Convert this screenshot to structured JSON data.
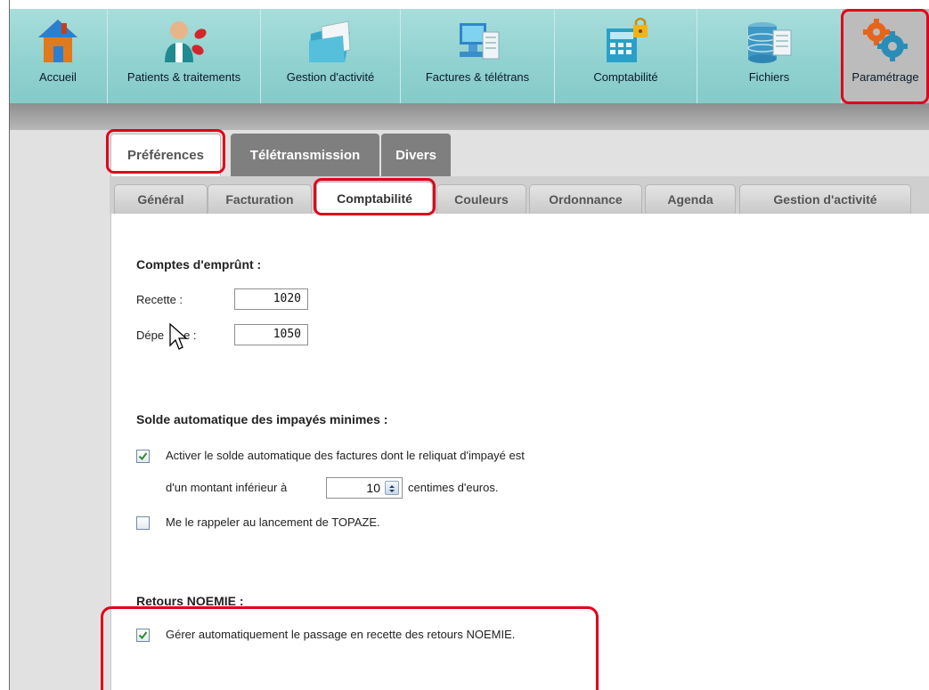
{
  "toolbar": {
    "items": [
      {
        "label": "Accueil",
        "icon": "home-icon"
      },
      {
        "label": "Patients & traitements",
        "icon": "patients-icon"
      },
      {
        "label": "Gestion d'activité",
        "icon": "folder-icon"
      },
      {
        "label": "Factures & télétrans",
        "icon": "computer-icon"
      },
      {
        "label": "Comptabilité",
        "icon": "calculator-lock-icon"
      },
      {
        "label": "Fichiers",
        "icon": "database-icon"
      },
      {
        "label": "Paramétrage",
        "icon": "gears-icon",
        "active": true
      }
    ]
  },
  "tabs_main": [
    "Préférences",
    "Télétransmission",
    "Divers"
  ],
  "tabs_sub": [
    "Général",
    "Facturation",
    "Comptabilité",
    "Couleurs",
    "Ordonnance",
    "Agenda",
    "Gestion d'activité"
  ],
  "accounts": {
    "title": "Comptes d'emprûnt :",
    "recette_label": "Recette :",
    "recette_value": "1020",
    "depense_label_start": "Dépe",
    "depense_label_end": "e :",
    "depense_value": "1050"
  },
  "solde": {
    "title": "Solde automatique des impayés minimes :",
    "enable_label_1": "Activer le solde automatique des factures dont le reliquat d'impayé est",
    "enable_label_2": "d'un montant inférieur à",
    "amount": "10",
    "unit": "centimes d'euros.",
    "enable_checked": true,
    "reminder_label": "Me le rappeler au lancement de TOPAZE.",
    "reminder_checked": false
  },
  "noemie": {
    "title": "Retours NOEMIE :",
    "label": "Gérer automatiquement le passage en recette des retours NOEMIE.",
    "checked": true
  },
  "colors": {
    "highlight": "#e0001b",
    "toolbar": "#8fd1cf",
    "check": "#2e8b2e"
  }
}
